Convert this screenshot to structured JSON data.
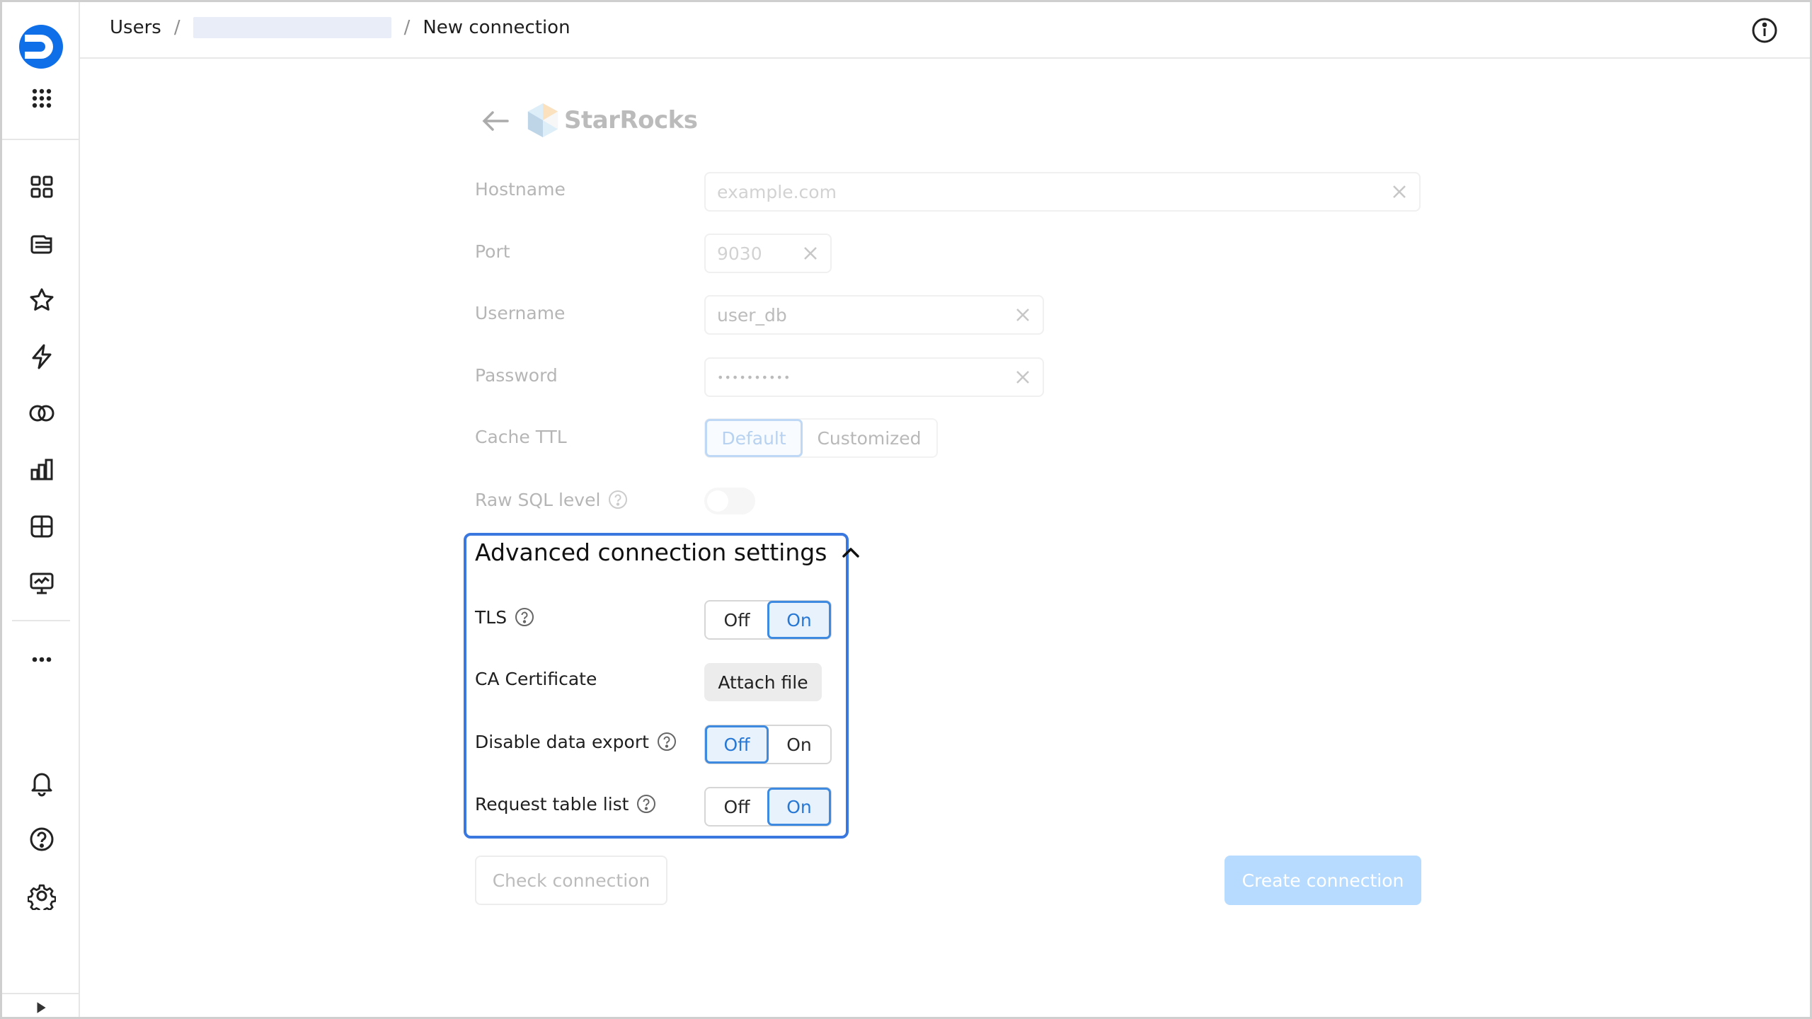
{
  "breadcrumb": {
    "item1": "Users",
    "sep": "/",
    "item3": "New connection"
  },
  "logo": {
    "name": "StarRocks"
  },
  "form": {
    "hostname": {
      "label": "Hostname",
      "placeholder": "example.com"
    },
    "port": {
      "label": "Port",
      "placeholder": "9030"
    },
    "username": {
      "label": "Username",
      "value": "user_db"
    },
    "password": {
      "label": "Password",
      "value": "••••••••••"
    },
    "cache_ttl": {
      "label": "Cache TTL",
      "options": [
        "Default",
        "Customized"
      ],
      "selected": "Default"
    },
    "raw_sql": {
      "label": "Raw SQL level",
      "toggle": "off"
    }
  },
  "advanced": {
    "title": "Advanced connection settings",
    "tls": {
      "label": "TLS",
      "off": "Off",
      "on": "On",
      "selected": "On"
    },
    "ca_cert": {
      "label": "CA Certificate",
      "button": "Attach file"
    },
    "disable_export": {
      "label": "Disable data export",
      "off": "Off",
      "on": "On",
      "selected": "Off"
    },
    "table_list": {
      "label": "Request table list",
      "off": "Off",
      "on": "On",
      "selected": "On"
    }
  },
  "actions": {
    "check": "Check connection",
    "create": "Create connection"
  },
  "colors": {
    "accent": "#3a78e0",
    "brand": "#0f6fe8",
    "create_disabled": "#b7dbff"
  },
  "icons": {
    "sidebar": [
      "logo-icon",
      "apps-grid-icon",
      "dashboard-grid-icon",
      "collections-icon",
      "star-icon",
      "lightning-icon",
      "rings-icon",
      "chart-icon",
      "table-icon",
      "monitor-icon",
      "more-icon",
      "bell-icon",
      "help-icon",
      "gear-icon",
      "expand-icon"
    ]
  }
}
